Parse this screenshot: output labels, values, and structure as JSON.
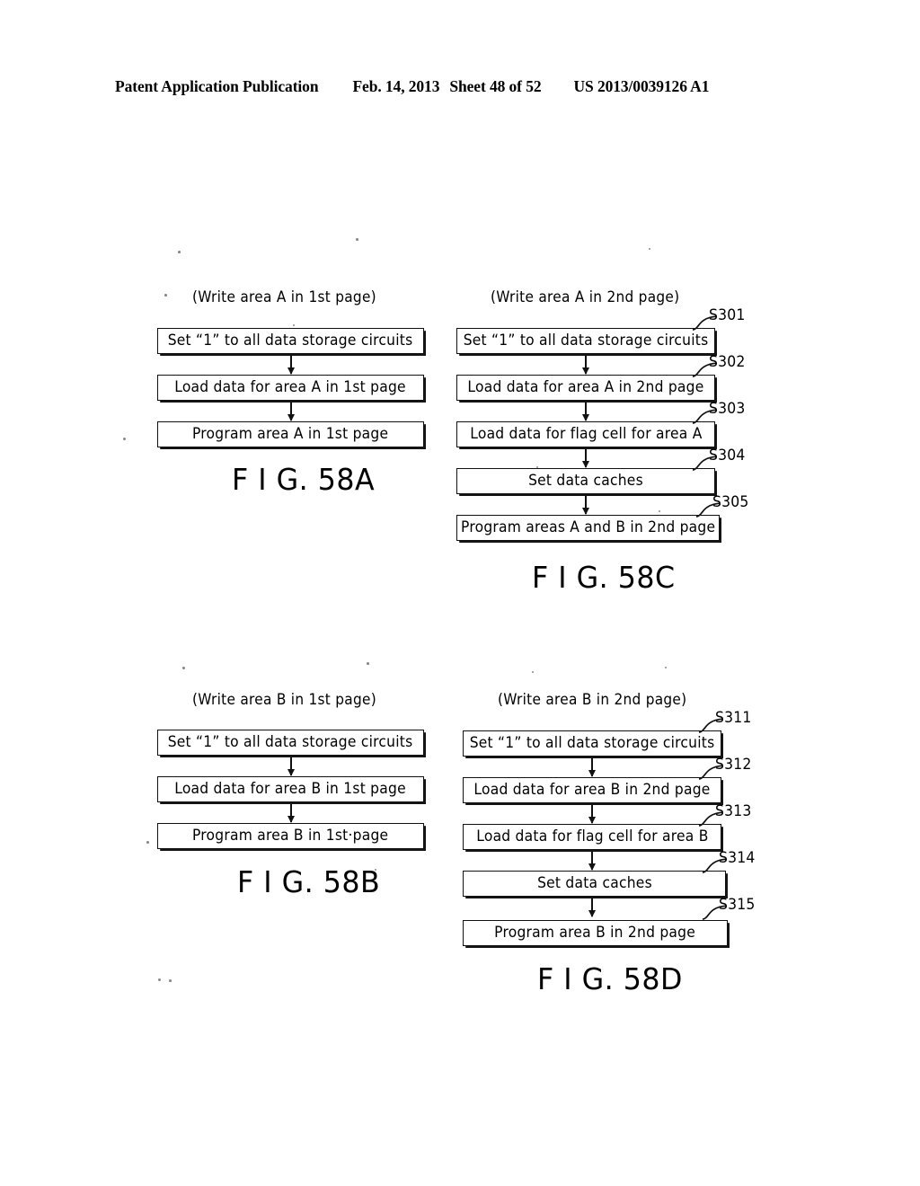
{
  "header": {
    "publication": "Patent Application Publication",
    "date": "Feb. 14, 2013",
    "sheet": "Sheet 48 of 52",
    "number": "US 2013/0039126 A1"
  },
  "figures": [
    {
      "id": "fig-58a",
      "title": "(Write area A in 1st page)",
      "caption": "F I G. 58A",
      "steps": [
        {
          "label": "Set “1” to all data storage circuits",
          "ref": ""
        },
        {
          "label": "Load data for area A in 1st page",
          "ref": ""
        },
        {
          "label": "Program area A in 1st page",
          "ref": ""
        }
      ]
    },
    {
      "id": "fig-58c",
      "title": "(Write area A in 2nd page)",
      "caption": "F I G. 58C",
      "steps": [
        {
          "label": "Set “1” to all data storage circuits",
          "ref": "S301"
        },
        {
          "label": "Load data for area A in 2nd page",
          "ref": "S302"
        },
        {
          "label": "Load data for flag cell for area A",
          "ref": "S303"
        },
        {
          "label": "Set data caches",
          "ref": "S304"
        },
        {
          "label": "Program areas A and B in 2nd page",
          "ref": "S305"
        }
      ]
    },
    {
      "id": "fig-58b",
      "title": "(Write area B in 1st page)",
      "caption": "F I G. 58B",
      "steps": [
        {
          "label": "Set “1” to all data storage circuits",
          "ref": ""
        },
        {
          "label": "Load data for area B in 1st page",
          "ref": ""
        },
        {
          "label": "Program area B in 1st·page",
          "ref": ""
        }
      ]
    },
    {
      "id": "fig-58d",
      "title": "(Write area B in 2nd page)",
      "caption": "F I G. 58D",
      "steps": [
        {
          "label": "Set “1” to all data storage circuits",
          "ref": "S311"
        },
        {
          "label": "Load data for area B in 2nd page",
          "ref": "S312"
        },
        {
          "label": "Load data for flag cell for area B",
          "ref": "S313"
        },
        {
          "label": "Set data caches",
          "ref": "S314"
        },
        {
          "label": "Program area B in 2nd page",
          "ref": "S315"
        }
      ]
    }
  ],
  "colors": {
    "ink": "#111111",
    "paper": "#ffffff"
  }
}
